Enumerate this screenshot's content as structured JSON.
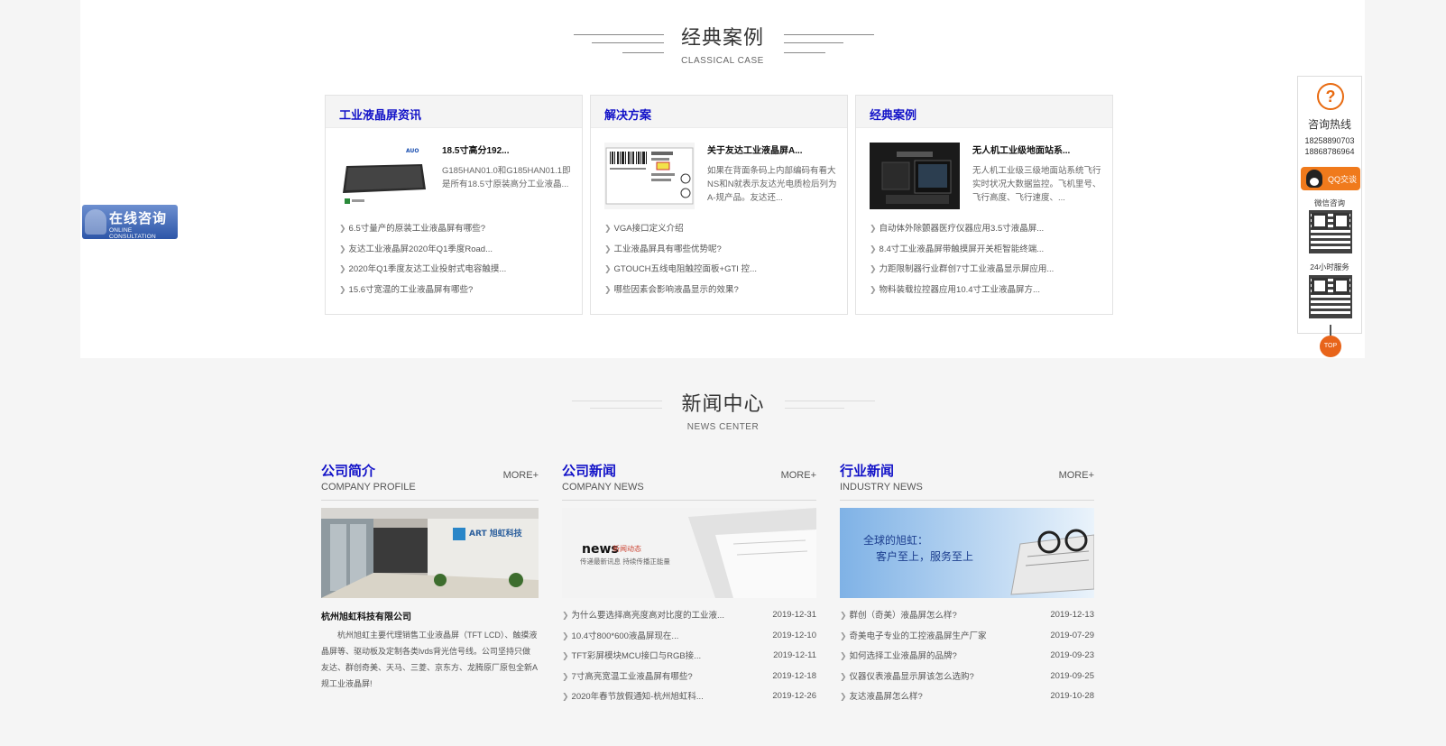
{
  "case_section": {
    "title": "经典案例",
    "subtitle": "CLASSICAL CASE",
    "cards": [
      {
        "heading": "工业液晶屏资讯",
        "feature_title": "18.5寸高分192...",
        "feature_desc": "G185HAN01.0和G185HAN01.1即是所有18.5寸原装高分工业液晶...",
        "thumb_icon": "lcd-panel-image",
        "items": [
          "6.5寸量产的原装工业液晶屏有哪些?",
          "友达工业液晶屏2020年Q1季度Road...",
          "2020年Q1季度友达工业投射式电容触摸...",
          "15.6寸宽温的工业液晶屏有哪些?"
        ]
      },
      {
        "heading": "解决方案",
        "feature_title": "关于友达工业液晶屏A...",
        "feature_desc": "如果在背面条码上内部编码有看大NS和N就表示友达光电质检后列为A-规产品。友达还...",
        "thumb_icon": "barcode-label-image",
        "items": [
          "VGA接口定义介绍",
          "工业液晶屏具有哪些优势呢?",
          "GTOUCH五线电阻触控面板+GTI 控...",
          "哪些因素会影响液晶显示的效果?"
        ]
      },
      {
        "heading": "经典案例",
        "feature_title": "无人机工业级地面站系...",
        "feature_desc": "无人机工业级三级地面站系统飞行实时状况大数据监控。飞机里号、飞行高度、飞行速度、...",
        "thumb_icon": "drone-station-image",
        "items": [
          "自动体外除颤器医疗仪器应用3.5寸液晶屏...",
          "8.4寸工业液晶屏带触摸屏开关柜智能终端...",
          "力距限制器行业群创7寸工业液晶显示屏应用...",
          "物料装载拉控器应用10.4寸工业液晶屏方..."
        ]
      }
    ]
  },
  "online_consult": {
    "cn": "在线咨询",
    "en": "ONLINE CONSULTATION"
  },
  "sidebar": {
    "hotline_label": "咨询热线",
    "tel1": "18258890703",
    "tel2": "18868786964",
    "qq_label": "QQ交谈",
    "wechat_label": "微信咨询",
    "service_label": "24小时服务",
    "top_label": "TOP",
    "accent": "#e86a10"
  },
  "news_section": {
    "title": "新闻中心",
    "subtitle": "NEWS CENTER",
    "columns": [
      {
        "cn": "公司简介",
        "en": "COMPANY PROFILE",
        "more": "MORE+",
        "company_name": "杭州旭虹科技有限公司",
        "company_desc": "杭州旭虹主要代理销售工业液晶屏（TFT LCD）、触摸液晶屏等、驱动板及定制各类lvds背光信号线。公司坚持只做友达、群创奇美、天马、三菱、京东方、龙腾原厂原包全新A规工业液晶屏!",
        "image_text": "ART 旭虹科技"
      },
      {
        "cn": "公司新闻",
        "en": "COMPANY NEWS",
        "more": "MORE+",
        "image_big": "news",
        "image_tag": "新闻动态",
        "image_sub": "传递最新讯息 持续传播正能量",
        "items": [
          {
            "t": "为什么要选择高亮度高对比度的工业液...",
            "d": "2019-12-31"
          },
          {
            "t": "10.4寸800*600液晶屏现在...",
            "d": "2019-12-10"
          },
          {
            "t": "TFT彩屏模块MCU接口与RGB接...",
            "d": "2019-12-11"
          },
          {
            "t": "7寸高亮宽温工业液晶屏有哪些?",
            "d": "2019-12-18"
          },
          {
            "t": "2020年春节放假通知-杭州旭虹科...",
            "d": "2019-12-26"
          }
        ]
      },
      {
        "cn": "行业新闻",
        "en": "INDUSTRY NEWS",
        "more": "MORE+",
        "image_line1": "全球的旭虹：",
        "image_line2": "客户至上，服务至上",
        "items": [
          {
            "t": "群创（奇美）液晶屏怎么样?",
            "d": "2019-12-13"
          },
          {
            "t": "奇美电子专业的工控液晶屏生产厂家",
            "d": "2019-07-29"
          },
          {
            "t": "如何选择工业液晶屏的品牌?",
            "d": "2019-09-23"
          },
          {
            "t": "仪器仪表液晶显示屏该怎么选购?",
            "d": "2019-09-25"
          },
          {
            "t": "友达液晶屏怎么样?",
            "d": "2019-10-28"
          }
        ]
      }
    ]
  }
}
